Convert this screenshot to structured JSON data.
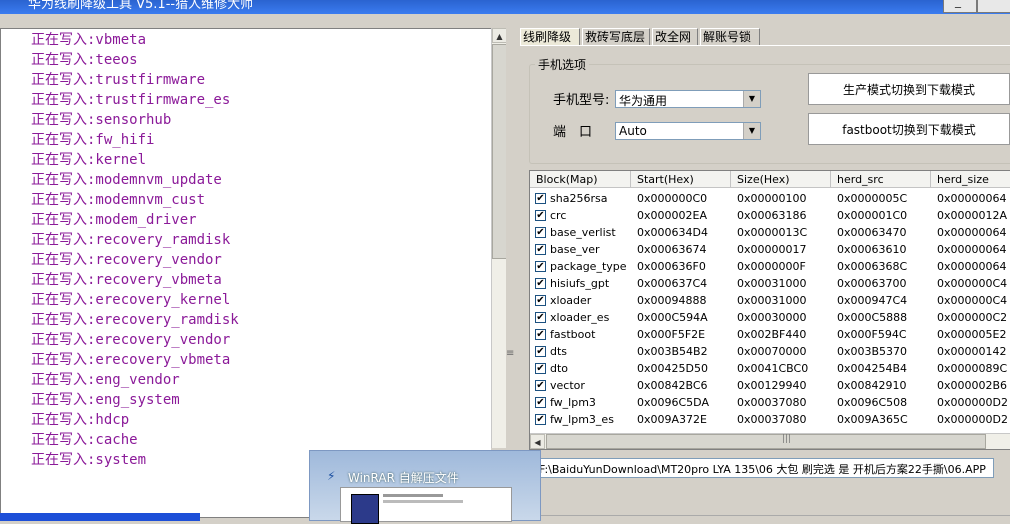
{
  "window": {
    "title": "华为线刷降级工具 V5.1--猎人维修大师"
  },
  "log": {
    "prefix": "正在写入:",
    "lines": [
      "正在写入:vbmeta",
      "正在写入:teeos",
      "正在写入:trustfirmware",
      "正在写入:trustfirmware_es",
      "正在写入:sensorhub",
      "正在写入:fw_hifi",
      "正在写入:kernel",
      "正在写入:modemnvm_update",
      "正在写入:modemnvm_cust",
      "正在写入:modem_driver",
      "正在写入:recovery_ramdisk",
      "正在写入:recovery_vendor",
      "正在写入:recovery_vbmeta",
      "正在写入:erecovery_kernel",
      "正在写入:erecovery_ramdisk",
      "正在写入:erecovery_vendor",
      "正在写入:erecovery_vbmeta",
      "正在写入:eng_vendor",
      "正在写入:eng_system",
      "正在写入:hdcp",
      "正在写入:cache",
      "正在写入:system"
    ]
  },
  "tabs": [
    "线刷降级",
    "救砖写底层",
    "改全网",
    "解账号锁"
  ],
  "phone_options": {
    "title": "手机选项",
    "model_label": "手机型号:",
    "model_value": "华为通用",
    "port_label": "端　口",
    "port_value": "Auto",
    "btn_factory": "生产模式切换到下载模式",
    "btn_fastboot": "fastboot切换到下载模式"
  },
  "table": {
    "columns": [
      "Block(Map)",
      "Start(Hex)",
      "Size(Hex)",
      "herd_src",
      "herd_size"
    ],
    "rows": [
      [
        "sha256rsa",
        "0x000000C0",
        "0x00000100",
        "0x0000005C",
        "0x00000064"
      ],
      [
        "crc",
        "0x000002EA",
        "0x00063186",
        "0x000001C0",
        "0x0000012A"
      ],
      [
        "base_verlist",
        "0x000634D4",
        "0x0000013C",
        "0x00063470",
        "0x00000064"
      ],
      [
        "base_ver",
        "0x00063674",
        "0x00000017",
        "0x00063610",
        "0x00000064"
      ],
      [
        "package_type",
        "0x000636F0",
        "0x0000000F",
        "0x0006368C",
        "0x00000064"
      ],
      [
        "hisiufs_gpt",
        "0x000637C4",
        "0x00031000",
        "0x00063700",
        "0x000000C4"
      ],
      [
        "xloader",
        "0x00094888",
        "0x00031000",
        "0x000947C4",
        "0x000000C4"
      ],
      [
        "xloader_es",
        "0x000C594A",
        "0x00030000",
        "0x000C5888",
        "0x000000C2"
      ],
      [
        "fastboot",
        "0x000F5F2E",
        "0x002BF440",
        "0x000F594C",
        "0x000005E2"
      ],
      [
        "dts",
        "0x003B54B2",
        "0x00070000",
        "0x003B5370",
        "0x00000142"
      ],
      [
        "dto",
        "0x00425D50",
        "0x0041CBC0",
        "0x004254B4",
        "0x0000089C"
      ],
      [
        "vector",
        "0x00842BC6",
        "0x00129940",
        "0x00842910",
        "0x000002B6"
      ],
      [
        "fw_lpm3",
        "0x0096C5DA",
        "0x00037080",
        "0x0096C508",
        "0x000000D2"
      ],
      [
        "fw_lpm3_es",
        "0x009A372E",
        "0x00037080",
        "0x009A365C",
        "0x000000D2"
      ]
    ]
  },
  "path": "F:\\BaiduYunDownload\\MT20pro LYA  135\\06 大包 刷完选 是 开机后方案22手撕\\06.APP",
  "popup": {
    "title": "WinRAR 自解压文件",
    "icon": "bolt-icon"
  },
  "icons": {
    "check": "✔",
    "scroll_up": "▲",
    "scroll_left": "◀",
    "scroll_right": "▶",
    "dropdown": "▼"
  }
}
